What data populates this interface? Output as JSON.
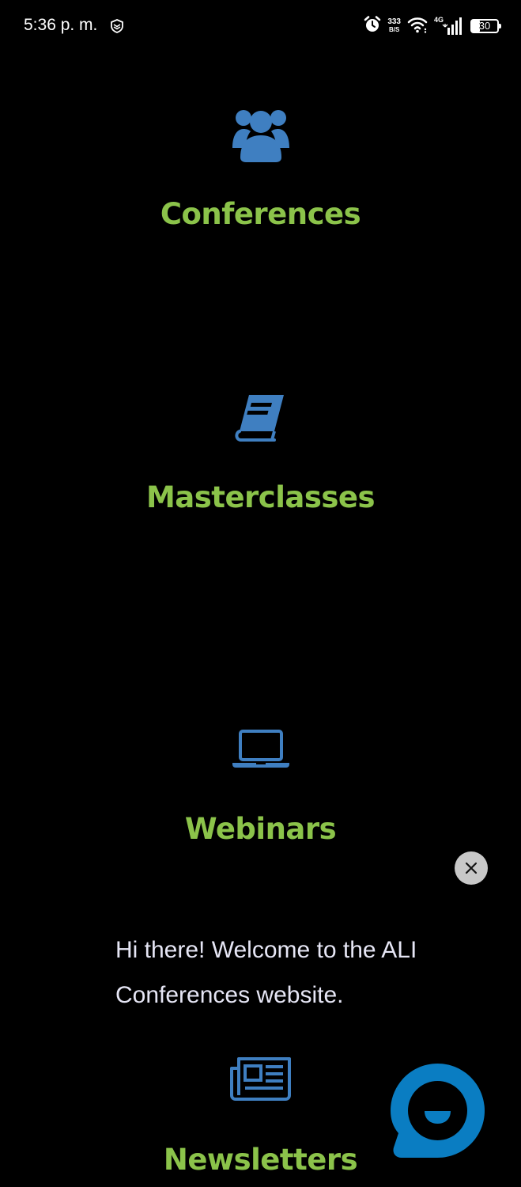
{
  "status_bar": {
    "time": "5:36 p. m.",
    "left_icon": "shield-notification-icon",
    "alarm_icon": "alarm-icon",
    "speed_value": "333",
    "speed_unit": "B/S",
    "wifi_icon": "wifi-icon",
    "network_label": "4G",
    "signal_icon": "signal-bars-icon",
    "battery_level": "30",
    "battery_fraction": 0.3
  },
  "sections": [
    {
      "title": "Conferences",
      "icon": "users-group-icon"
    },
    {
      "title": "Masterclasses",
      "icon": "book-icon"
    },
    {
      "title": "Webinars",
      "icon": "laptop-icon"
    },
    {
      "title": "Newsletters",
      "icon": "newspaper-icon"
    }
  ],
  "chat": {
    "message": "Hi there! Welcome to the ALI Conferences website.",
    "close_icon": "close-icon",
    "launcher_icon": "chat-bubble-icon"
  },
  "colors": {
    "background": "#000000",
    "accent_green": "#8bc34a",
    "icon_blue": "#3f7fc1",
    "chat_blue": "#0a7dc2",
    "close_bg": "#c8c8c8",
    "message_text": "#e6e6f5"
  }
}
